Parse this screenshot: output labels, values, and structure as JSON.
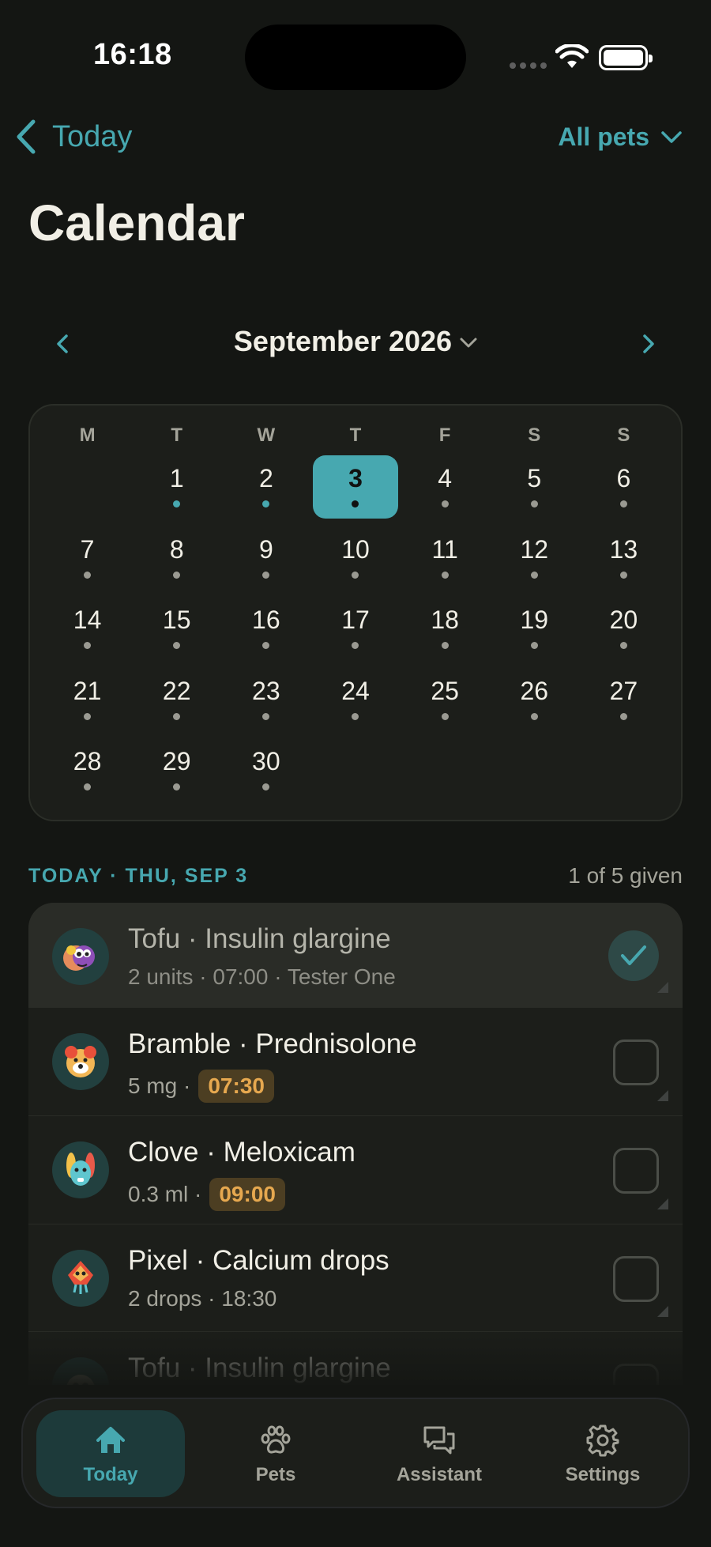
{
  "status_bar": {
    "time": "16:18"
  },
  "nav": {
    "back_label": "Today",
    "pet_filter": "All pets"
  },
  "page": {
    "title": "Calendar"
  },
  "month_nav": {
    "label": "September 2026"
  },
  "calendar": {
    "weekdays": [
      "M",
      "T",
      "W",
      "T",
      "F",
      "S",
      "S"
    ],
    "days": [
      {
        "num": ""
      },
      {
        "num": "1",
        "dot": "accent"
      },
      {
        "num": "2",
        "dot": "accent"
      },
      {
        "num": "3",
        "dot": "dark",
        "selected": true
      },
      {
        "num": "4",
        "dot": "grey"
      },
      {
        "num": "5",
        "dot": "grey"
      },
      {
        "num": "6",
        "dot": "grey"
      },
      {
        "num": "7",
        "dot": "grey"
      },
      {
        "num": "8",
        "dot": "grey"
      },
      {
        "num": "9",
        "dot": "grey"
      },
      {
        "num": "10",
        "dot": "grey"
      },
      {
        "num": "11",
        "dot": "grey"
      },
      {
        "num": "12",
        "dot": "grey"
      },
      {
        "num": "13",
        "dot": "grey"
      },
      {
        "num": "14",
        "dot": "grey"
      },
      {
        "num": "15",
        "dot": "grey"
      },
      {
        "num": "16",
        "dot": "grey"
      },
      {
        "num": "17",
        "dot": "grey"
      },
      {
        "num": "18",
        "dot": "grey"
      },
      {
        "num": "19",
        "dot": "grey"
      },
      {
        "num": "20",
        "dot": "grey"
      },
      {
        "num": "21",
        "dot": "grey"
      },
      {
        "num": "22",
        "dot": "grey"
      },
      {
        "num": "23",
        "dot": "grey"
      },
      {
        "num": "24",
        "dot": "grey"
      },
      {
        "num": "25",
        "dot": "grey"
      },
      {
        "num": "26",
        "dot": "grey"
      },
      {
        "num": "27",
        "dot": "grey"
      },
      {
        "num": "28",
        "dot": "grey"
      },
      {
        "num": "29",
        "dot": "grey"
      },
      {
        "num": "30",
        "dot": "grey"
      }
    ]
  },
  "schedule": {
    "title": "TODAY · THU, SEP 3",
    "count": "1 of 5 given",
    "doses": [
      {
        "title": "Tofu · Insulin glargine",
        "sub": "2 units · 07:00 · Tester One",
        "chip": "",
        "given": true,
        "avatar": "tofu"
      },
      {
        "title": "Bramble · Prednisolone",
        "sub": "5 mg ·",
        "chip": "07:30",
        "given": false,
        "avatar": "bramble"
      },
      {
        "title": "Clove · Meloxicam",
        "sub": "0.3 ml ·",
        "chip": "09:00",
        "given": false,
        "avatar": "clove"
      },
      {
        "title": "Pixel · Calcium drops",
        "sub": "2 drops · 18:30",
        "chip": "",
        "given": false,
        "avatar": "pixel"
      },
      {
        "title": "Tofu · Insulin glargine",
        "sub": "",
        "chip": "",
        "given": false,
        "avatar": "tofu2"
      }
    ]
  },
  "tab_bar": {
    "tabs": [
      {
        "label": "Today",
        "icon": "house-icon",
        "active": true
      },
      {
        "label": "Pets",
        "icon": "paw-icon",
        "active": false
      },
      {
        "label": "Assistant",
        "icon": "chat-bubbles-icon",
        "active": false
      },
      {
        "label": "Settings",
        "icon": "gear-icon",
        "active": false
      }
    ]
  },
  "colors": {
    "accent": "#47a8b0",
    "background": "#141613",
    "card": "#1c1e1a",
    "time_chip_text": "#e6a84f",
    "time_chip_bg": "#4c3e22"
  }
}
